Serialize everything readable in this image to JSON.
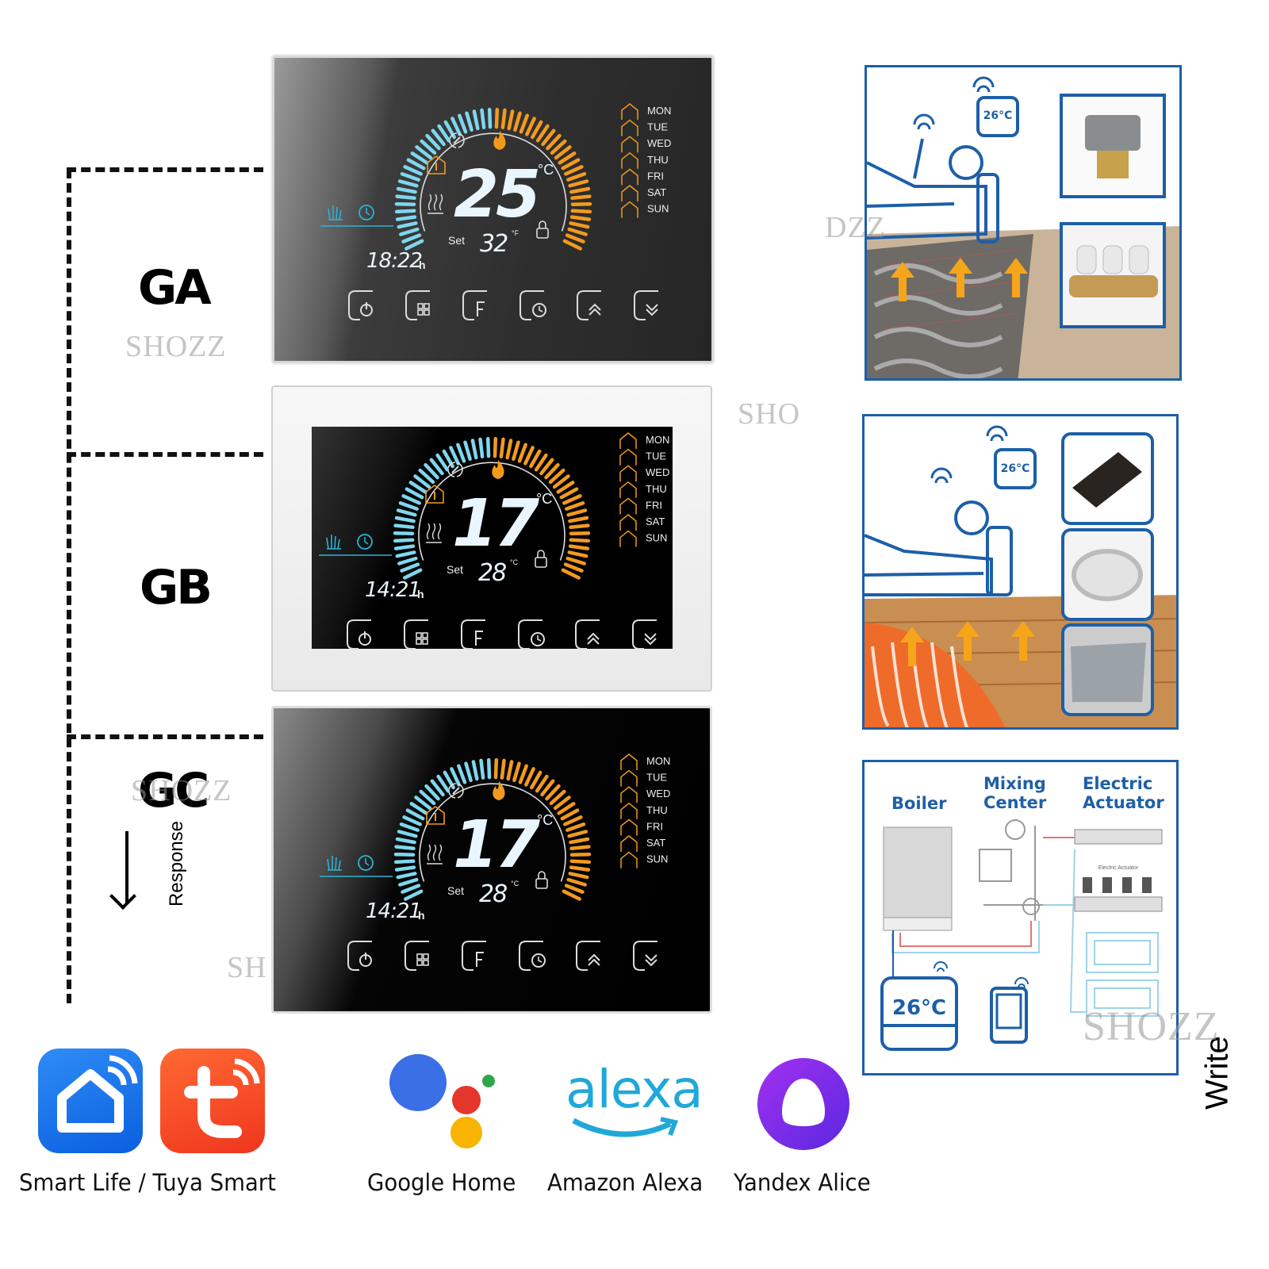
{
  "models": [
    {
      "label": "GA",
      "temp": "25",
      "temp_unit": "°C",
      "set_label": "Set",
      "set_temp": "32",
      "set_unit": "°F",
      "time": "18:22",
      "time_suffix": "h",
      "days": [
        "MON",
        "TUE",
        "WED",
        "THU",
        "FRI",
        "SAT",
        "SUN"
      ],
      "finish": "brushed-gray"
    },
    {
      "label": "GB",
      "temp": "17",
      "temp_unit": "°C",
      "set_label": "Set",
      "set_temp": "28",
      "set_unit": "°C",
      "time": "14:21",
      "time_suffix": "h",
      "days": [
        "MON",
        "TUE",
        "WED",
        "THU",
        "FRI",
        "SAT",
        "SUN"
      ],
      "finish": "white"
    },
    {
      "label": "GC",
      "temp": "17",
      "temp_unit": "°C",
      "set_label": "Set",
      "set_temp": "28",
      "set_unit": "°C",
      "time": "14:21",
      "time_suffix": "h",
      "days": [
        "MON",
        "TUE",
        "WED",
        "THU",
        "FRI",
        "SAT",
        "SUN"
      ],
      "finish": "black"
    }
  ],
  "thermostat_icons": [
    "power-icon",
    "mode-grid-icon",
    "fan-f-icon",
    "schedule-clock-icon",
    "chevron-up-icon",
    "chevron-down-icon"
  ],
  "colors": {
    "cold": "#7fd6ee",
    "hot": "#f39a1e",
    "frame_blue": "#1d5fa8",
    "diagram_text": "#1f5fa6"
  },
  "response_label": "Response",
  "write_label": "Write",
  "watermark": "SHOZZ",
  "scenes": {
    "water_heating": {
      "thermostat_display": "26°C"
    },
    "electric_heating": {
      "thermostat_display": "26°C"
    },
    "diagram": {
      "boiler": "Boiler",
      "mixing_center": "Mixing Center",
      "electric_actuator": "Electric Actuator",
      "actuator_small": "Electric Actuator",
      "thermostat_display": "26°C"
    }
  },
  "apps": [
    {
      "name": "Smart Life / Tuya Smart"
    },
    {
      "name": "Google Home"
    },
    {
      "name": "Amazon Alexa",
      "logo_text": "alexa"
    },
    {
      "name": "Yandex Alice"
    }
  ]
}
